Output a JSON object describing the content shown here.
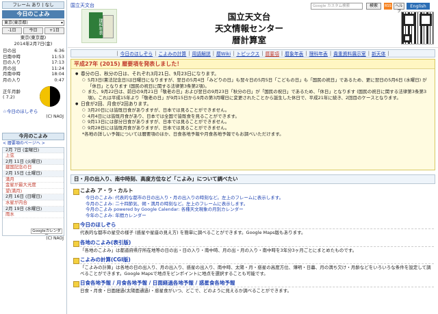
{
  "left": {
    "frame_bar": "フレーム あり | なし",
    "today_title": "今日のこよみ",
    "pref_select": "東京(東京都)",
    "buttons": [
      "-1日",
      "今日",
      "+1日"
    ],
    "place": "東京(東京都)",
    "date": "2014年2月7日(金)",
    "rows": [
      {
        "label": "日の出",
        "value": "6:36"
      },
      {
        "label": "日南中時",
        "value": "11:53"
      },
      {
        "label": "日の入り",
        "value": "17:13"
      },
      {
        "label": "月の出",
        "value": "11:24"
      },
      {
        "label": "月南中時",
        "value": "18:04"
      },
      {
        "label": "月の入り",
        "value": "0:47"
      }
    ],
    "moon_age_label": "正午月齢",
    "moon_age_value": "( 7.2)",
    "today_link": "☆今日のほしぞら",
    "copyright": "(C) NAOJ",
    "kon_title": "今月のこよみ",
    "kon_sub": "< 暦要項のページへ >",
    "calendar": [
      {
        "text": "2月 7日 (金曜日)",
        "kind": "date"
      },
      {
        "text": "上弦",
        "kind": "red"
      },
      {
        "text": "2月 11日 (火曜日)",
        "kind": "date"
      },
      {
        "text": "建国記念の日",
        "kind": "red"
      },
      {
        "text": "2月 15日 (土曜日)",
        "kind": "date"
      },
      {
        "text": "満月",
        "kind": "red"
      },
      {
        "text": "金星が最大光度",
        "kind": "red"
      },
      {
        "text": "望(満月)",
        "kind": "red"
      },
      {
        "text": "2月 16日 (日曜日)",
        "kind": "date"
      },
      {
        "text": "水星が内合",
        "kind": "red"
      },
      {
        "text": "2月 19日 (水曜日)",
        "kind": "date"
      },
      {
        "text": "雨水",
        "kind": "red"
      }
    ],
    "gcal_button": "Googleカレンダー",
    "copyright2": "(C) NAOJ"
  },
  "header": {
    "home_link": "国立天文台",
    "book_label": "理科年表",
    "title_lines": [
      "国立天文台",
      "天文情報センター",
      "暦計算室"
    ],
    "search_placeholder": "Google カスタム検索",
    "search_button": "検索",
    "rss": "RSS",
    "help": "ヘルプ",
    "english": "English"
  },
  "nav": [
    {
      "label": "今日のほしぞら",
      "active": false
    },
    {
      "label": "こよみの計算",
      "active": false
    },
    {
      "label": "用語解説",
      "active": false
    },
    {
      "label": "暦Wiki",
      "active": false
    },
    {
      "label": "トピックス",
      "active": false
    },
    {
      "label": "暦要項",
      "active": true
    },
    {
      "label": "暦象年表",
      "active": false
    },
    {
      "label": "理科年表",
      "active": false
    },
    {
      "label": "貴重資料展示室",
      "active": false
    },
    {
      "label": "新天体",
      "active": false
    }
  ],
  "notice": {
    "heading": "平成27年 (2015) 暦要項を発表しました！",
    "b1": "春分の日、秋分の日は、それぞれ3月21日、9月23日になります。",
    "s1": "5月3日(憲法記念日)は日曜日になりますが、翌日の5月4日「みどりの日」も翌々日の5月5日「こどもの日」も「国民の祝日」であるため、更に翌日の5月6日 (水曜日) が「休日」となります (国民の祝日に関する法律第3条第2項)。",
    "s2": "また、9月22日は、前日の9月21日「敬老の日」および翌日の9月23日「秋分の日」が「国民の祝日」であるため、「休日」となります (国民の祝日に関する法律第3条第3項)。これは平成15年より「敬老の日」が9月15日から9月の第3月曜日に変更されたことから誕生した休日で、平成21年に続き、2回目のケースとなります。",
    "b2": "日食が2回、月食が2回あります。",
    "e1": "3月20日には皆既日食がありますが、日本では見ることができません。",
    "e2": "4月4日には皆既月食があり、日本では全国で皆既食を見ることができます。",
    "e3": "9月13日には部分日食がありますが、日本では見ることができません。",
    "e4": "9月28日には皆既月食がありますが、日本では見ることができません。",
    "note": "*各地の詳しい予報については暦要項のほか、日食各地予報や月食各地予報でもお調べいただけます。"
  },
  "section": {
    "bar": "日・月の出入り、南中時刻、高度方位など「こよみ」について調べたい",
    "koyomi_title": "こよみ ア・ラ・カルト",
    "koyomi_items": [
      "今日のこよみ: 代表的な都市の日の出入り・月の出入りの時刻など。左上のフレームに表示します。",
      "今月のこよみ: 二十四節気、朔・満月の時刻など。左上のフレームに表示します。",
      "今月のこよみ powered by Google Calendar: 各種天文現象の月別カレンダー",
      "今年のこよみ: 年間カレンダー"
    ],
    "hoshi_title": "今日のほしぞら",
    "hoshi_desc": "代表的な都市の星空の様子 (惑星や星座の見え方) を簡単に調べることができます。Google Maps版もあります。",
    "kakuchi_title": "各地のこよみ(表引版)",
    "kakuchi_desc": "「各地のこよみ」は都道府県庁所在地等の日の出・日の入り・南中時、月の出・月の入り・南中時を3年分3ヶ月ごとにまとめたものです。",
    "cgi_title": "こよみの計算(CGI版)",
    "cgi_desc": "「こよみの計算」は各地の日の出入り、月の出入り、惑星の出入り、南中時、太陽・月・惑星の高度方位、薄明・日暮、月の満ち欠け・月齢などをいろいろな条件を設定して調べることができます。Google Mapsで地点をピンポイントに地点を選択することも可能です。",
    "eclipse_title": "日食各地予報 / 月食各地予報 / 日面経過各地予報 / 惑星食各地予報",
    "eclipse_desc": "日食・月食・日面経過(太陽面通過)・惑星食がいつ、どこで、どのように見えるか調べることができます。"
  }
}
